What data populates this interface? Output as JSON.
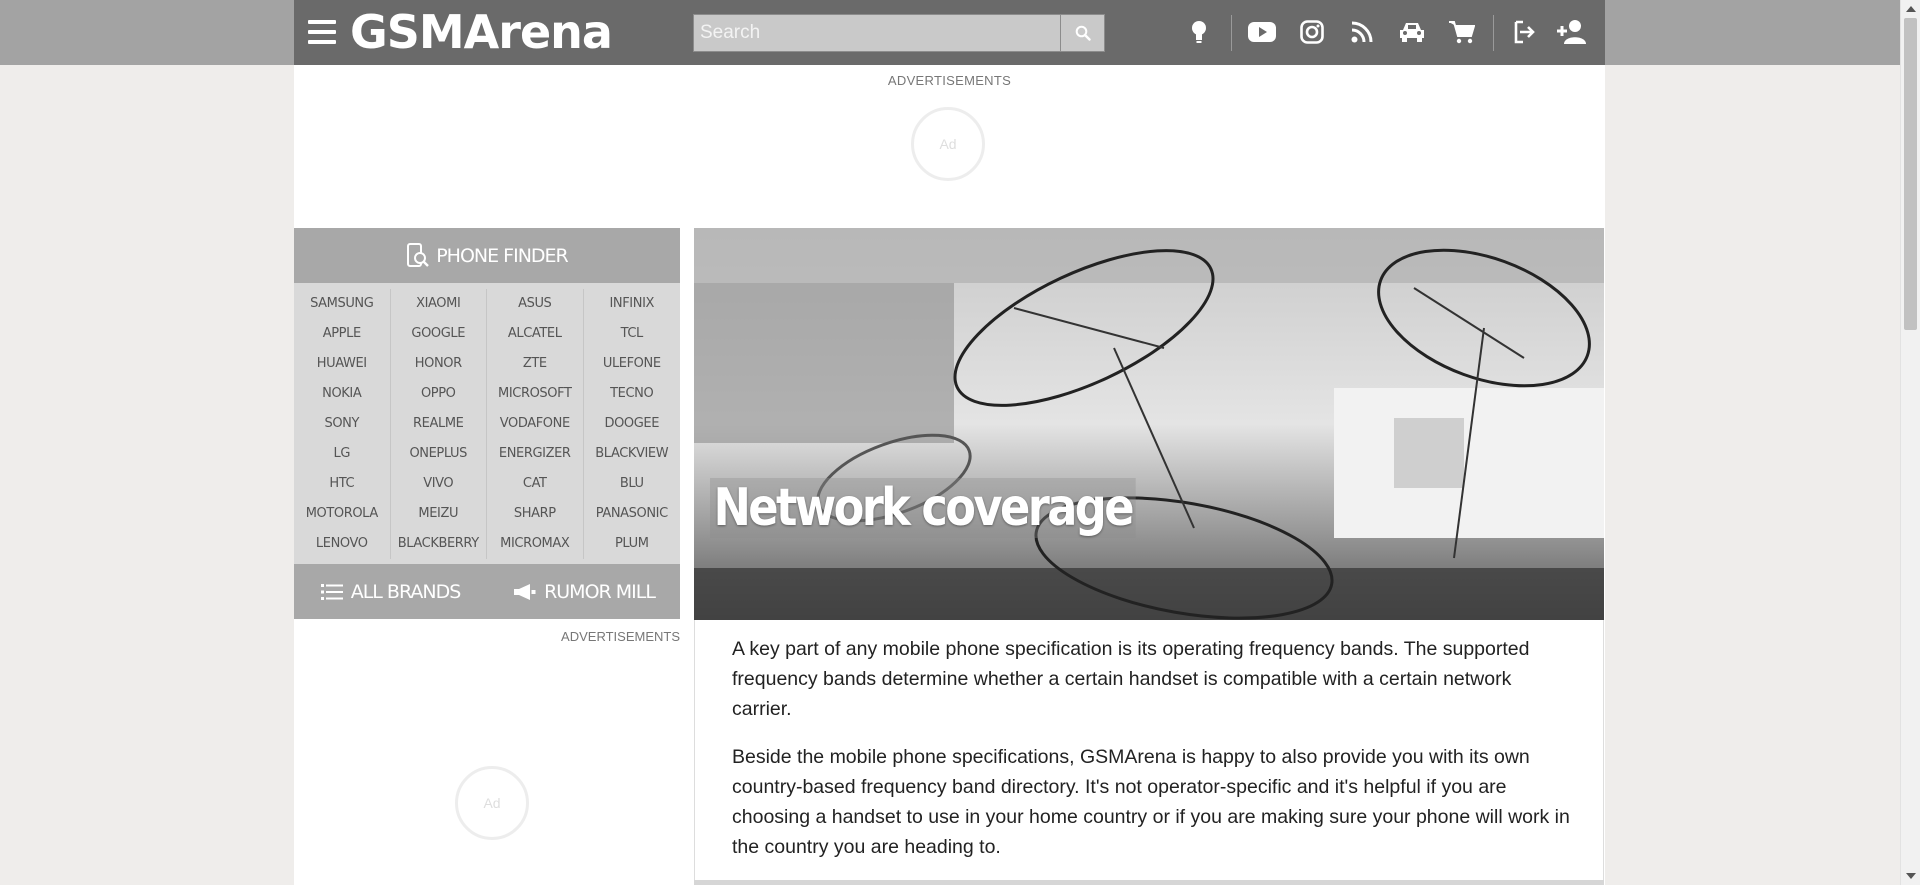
{
  "header": {
    "logo": "GSMArena",
    "search": {
      "placeholder": "Search"
    },
    "icons": [
      "lightbulb-icon",
      "youtube-icon",
      "instagram-icon",
      "rss-icon",
      "car-icon",
      "cart-icon",
      "login-icon",
      "add-user-icon"
    ]
  },
  "ads": {
    "top_label": "ADVERTISEMENTS",
    "side_label": "ADVERTISEMENTS",
    "spinner_text": "Ad"
  },
  "phone_finder": {
    "title": "PHONE FINDER",
    "columns": [
      [
        "SAMSUNG",
        "APPLE",
        "HUAWEI",
        "NOKIA",
        "SONY",
        "LG",
        "HTC",
        "MOTOROLA",
        "LENOVO"
      ],
      [
        "XIAOMI",
        "GOOGLE",
        "HONOR",
        "OPPO",
        "REALME",
        "ONEPLUS",
        "VIVO",
        "MEIZU",
        "BLACKBERRY"
      ],
      [
        "ASUS",
        "ALCATEL",
        "ZTE",
        "MICROSOFT",
        "VODAFONE",
        "ENERGIZER",
        "CAT",
        "SHARP",
        "MICROMAX"
      ],
      [
        "INFINIX",
        "TCL",
        "ULEFONE",
        "TECNO",
        "DOOGEE",
        "BLACKVIEW",
        "BLU",
        "PANASONIC",
        "PLUM"
      ]
    ],
    "all_brands": "ALL BRANDS",
    "rumor_mill": "RUMOR MILL"
  },
  "article": {
    "title": "Network coverage",
    "paragraphs": [
      "A key part of any mobile phone specification is its operating frequency bands. The supported frequency bands determine whether a certain handset is compatible with a certain network carrier.",
      "Beside the mobile phone specifications, GSMArena is happy to also provide you with its own country-based frequency band directory. It's not operator-specific and it's helpful if you are choosing a handset to use in your home country or if you are making sure your phone will work in the country you are heading to."
    ]
  }
}
